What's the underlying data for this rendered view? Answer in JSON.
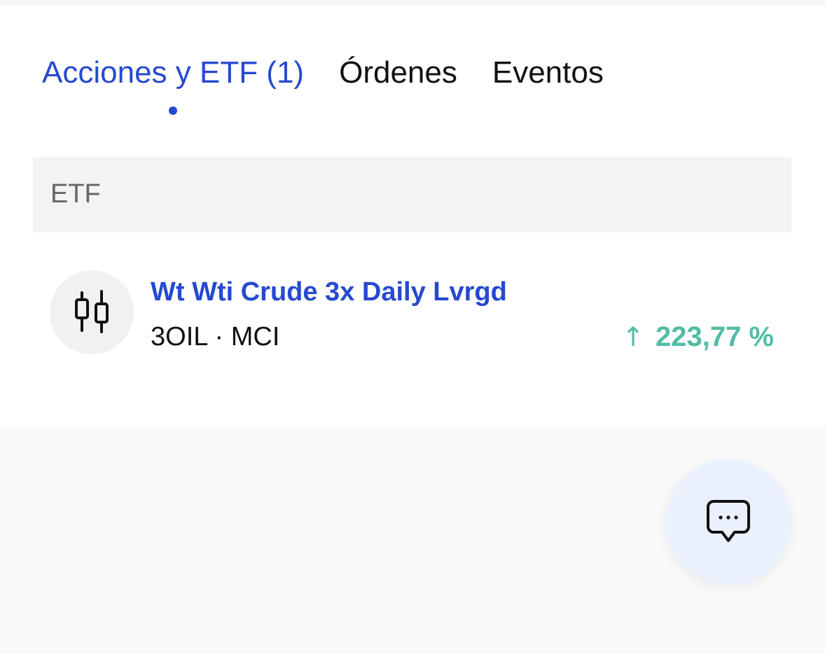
{
  "tabs": [
    {
      "label": "Acciones y ETF (1)",
      "active": true
    },
    {
      "label": "Órdenes",
      "active": false
    },
    {
      "label": "Eventos",
      "active": false
    }
  ],
  "section": {
    "label": "ETF"
  },
  "items": [
    {
      "icon": "candlestick-icon",
      "name": "Wt Wti Crude 3x Daily Lvrgd",
      "subtitle": "3OIL · MCI",
      "change_arrow": "↑",
      "change": "223,77 %"
    }
  ],
  "chat": {
    "icon": "chat-bubble-icon"
  },
  "colors": {
    "accent": "#2549d0",
    "positive": "#52bca5",
    "section_bg": "#f3f3f3",
    "fab_bg": "#eaf1fd"
  }
}
